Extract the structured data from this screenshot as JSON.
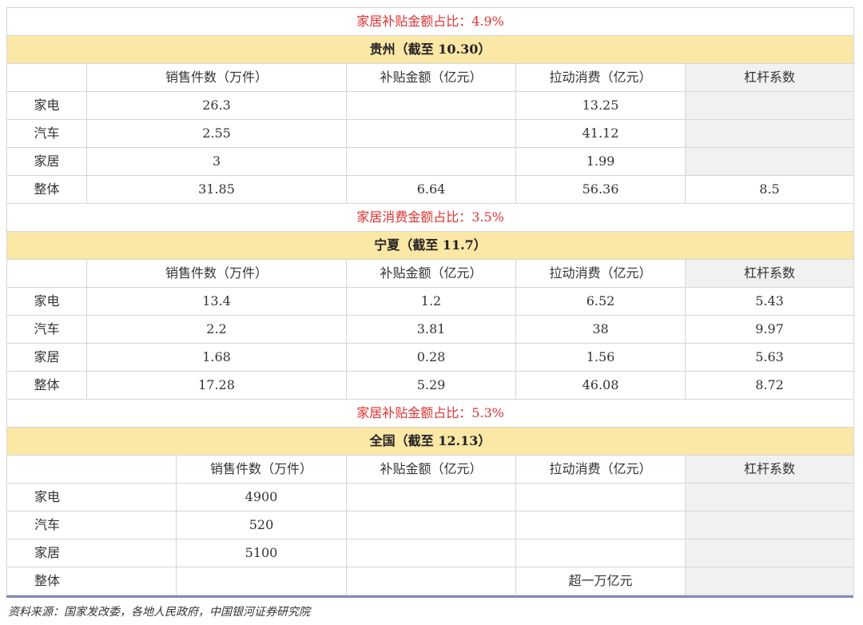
{
  "sections": [
    {
      "note": "家居补贴金额占比：4.9%",
      "title": "贵州（截至 10.30）",
      "headers": [
        "",
        "销售件数（万件）",
        "补贴金额（亿元）",
        "拉动消费（亿元）",
        "杠杆系数"
      ],
      "rows": [
        [
          "家电",
          "26.3",
          "",
          "13.25",
          ""
        ],
        [
          "汽车",
          "2.55",
          "",
          "41.12",
          ""
        ],
        [
          "家居",
          "3",
          "",
          "1.99",
          ""
        ],
        [
          "整体",
          "31.85",
          "6.64",
          "56.36",
          "8.5"
        ]
      ]
    },
    {
      "note": "家居消费金额占比：3.5%",
      "title": "宁夏（截至 11.7）",
      "headers": [
        "",
        "销售件数（万件）",
        "补贴金额（亿元）",
        "拉动消费（亿元）",
        "杠杆系数"
      ],
      "rows": [
        [
          "家电",
          "13.4",
          "1.2",
          "6.52",
          "5.43"
        ],
        [
          "汽车",
          "2.2",
          "3.81",
          "38",
          "9.97"
        ],
        [
          "家居",
          "1.68",
          "0.28",
          "1.56",
          "5.63"
        ],
        [
          "整体",
          "17.28",
          "5.29",
          "46.08",
          "8.72"
        ]
      ]
    },
    {
      "note": "家居补贴金额占比：5.3%",
      "title": "全国（截至 12.13）",
      "headers": [
        "",
        "销售件数（万件）",
        "补贴金额（亿元）",
        "拉动消费（亿元）",
        "杠杆系数"
      ],
      "rows": [
        [
          "家电",
          "4900",
          "",
          "",
          ""
        ],
        [
          "汽车",
          "520",
          "",
          "",
          ""
        ],
        [
          "家居",
          "5100",
          "",
          "",
          ""
        ],
        [
          "整体",
          "",
          "",
          "超一万亿元",
          ""
        ]
      ]
    }
  ],
  "source": "资料来源：国家发改委，各地人民政府，中国银河证券研究院",
  "colors": {
    "note_red": "#e03131",
    "section_header_bg": "#fbe7a6",
    "leverage_column_bg": "#f1f1f1",
    "border": "#d6d6d6",
    "bottom_rule": "#7d8fb8"
  }
}
